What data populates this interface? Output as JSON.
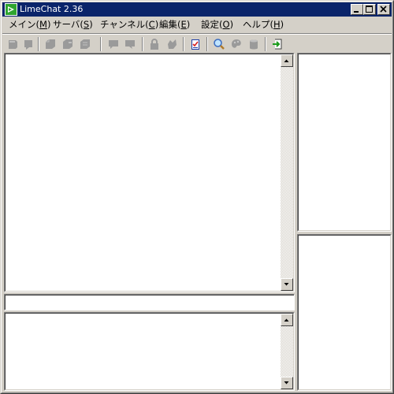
{
  "window": {
    "title": "LimeChat 2.36",
    "app_icon": "limechat-app-icon",
    "caption_buttons": [
      "minimize-icon",
      "maximize-icon",
      "close-icon"
    ]
  },
  "menu": {
    "items": [
      {
        "label": "メイン(",
        "key": "M",
        "end": ")"
      },
      {
        "label": "サーバ(",
        "key": "S",
        "end": ")"
      },
      {
        "label": "チャンネル(",
        "key": "C",
        "end": ")"
      },
      {
        "label": "編集(",
        "key": "E",
        "end": ")"
      },
      {
        "label": "設定(",
        "key": "O",
        "end": ")"
      },
      {
        "label": "ヘルプ(",
        "key": "H",
        "end": ")"
      }
    ]
  },
  "toolbar": {
    "buttons": [
      {
        "icon": "connect-icon",
        "enabled": false
      },
      {
        "icon": "disconnect-icon",
        "enabled": false
      },
      {
        "icon": "join-channel-icon",
        "enabled": false
      },
      {
        "icon": "leave-channel-icon",
        "enabled": false
      },
      {
        "icon": "channel-list-icon",
        "enabled": false
      },
      {
        "icon": "talk-icon",
        "enabled": false
      },
      {
        "icon": "dcc-icon",
        "enabled": false
      },
      {
        "icon": "lock-icon",
        "enabled": false
      },
      {
        "icon": "away-icon",
        "enabled": false
      },
      {
        "icon": "checklist-icon",
        "enabled": true
      },
      {
        "icon": "search-icon",
        "enabled": true
      },
      {
        "icon": "palette-icon",
        "enabled": false
      },
      {
        "icon": "log-icon",
        "enabled": false
      },
      {
        "icon": "exit-icon",
        "enabled": true
      }
    ]
  },
  "panes": {
    "log_view": {
      "lines": []
    },
    "input_box": {
      "value": "",
      "placeholder": ""
    },
    "console_view": {
      "lines": []
    },
    "server_tree": {
      "items": []
    },
    "member_list": {
      "items": []
    }
  }
}
